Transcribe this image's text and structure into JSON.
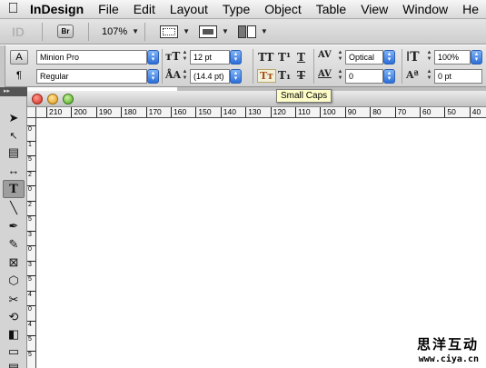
{
  "menubar": {
    "apple": "",
    "items": [
      "InDesign",
      "File",
      "Edit",
      "Layout",
      "Type",
      "Object",
      "Table",
      "View",
      "Window",
      "He"
    ]
  },
  "appbar": {
    "logo": "ID",
    "bridge_label": "Br",
    "zoom": "107%"
  },
  "control": {
    "char_mode": "A",
    "para_mode": "¶",
    "font_family": "Minion Pro",
    "font_style": "Regular",
    "font_size": "12 pt",
    "leading": "(14.4 pt)",
    "kerning": "Optical",
    "tracking": "0",
    "vertical_scale": "100%",
    "baseline_shift": "0 pt",
    "all_caps": "TT",
    "superscript": "T¹",
    "underline": "T",
    "small_caps": "Tт",
    "subscript": "T₁",
    "strikethrough": "T"
  },
  "tooltip": "Small Caps",
  "ruler": {
    "h_labels": [
      "210",
      "200",
      "190",
      "180",
      "170",
      "160",
      "150",
      "140",
      "130",
      "120",
      "110",
      "100",
      "90",
      "80",
      "70",
      "60",
      "50",
      "40"
    ],
    "v_labels": [
      "0",
      "1",
      "5",
      "2",
      "0",
      "2",
      "5",
      "3",
      "0",
      "3",
      "5",
      "4",
      "0",
      "4",
      "5",
      "5"
    ]
  },
  "watermark": {
    "chinese": "思洋互动",
    "url": "www.ciya.cn"
  },
  "colors": {
    "tooltip_bg": "#fffec8",
    "dropdown_blue": "#2e6fd8"
  }
}
